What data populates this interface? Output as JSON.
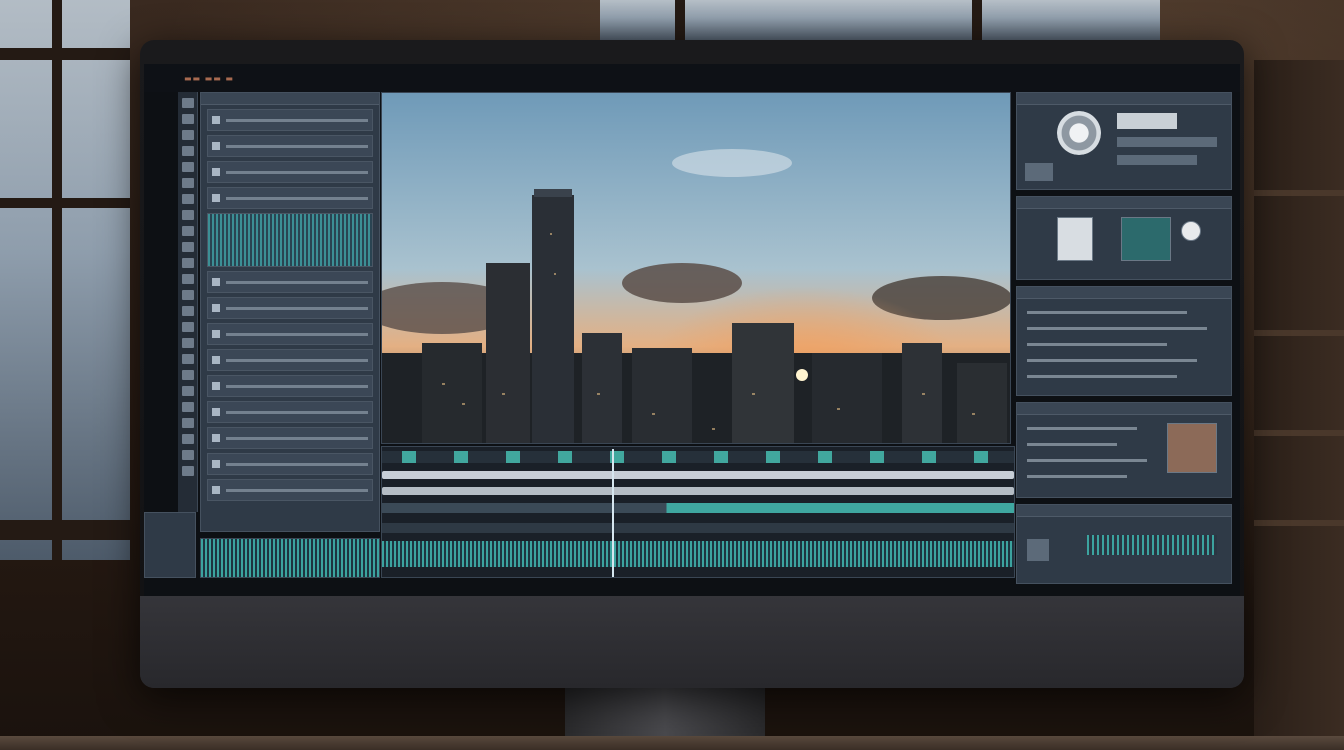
{
  "colors": {
    "accent_teal": "#3fa7a0",
    "panel_bg": "#2f3a47",
    "sky_top": "#7fa8c4",
    "sunset_glow": "#f0a060"
  },
  "icons": {
    "knob": "jog-wheel-icon",
    "playhead": "playhead-icon"
  }
}
